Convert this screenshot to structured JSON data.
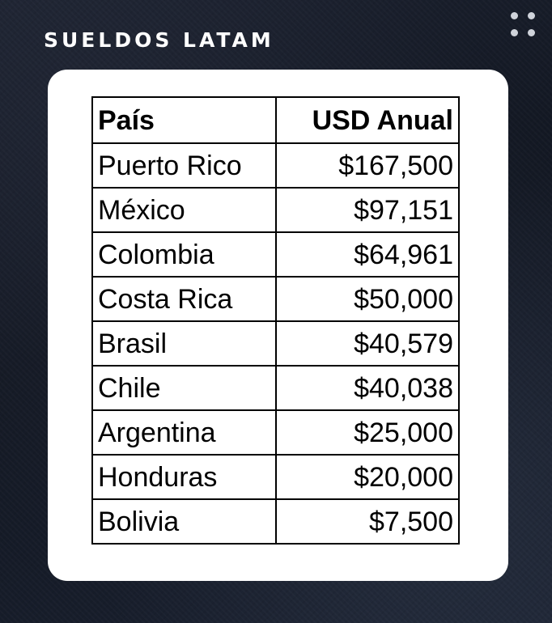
{
  "header": {
    "title": "SUELDOS LATAM"
  },
  "table": {
    "columns": [
      "País",
      "USD Anual"
    ],
    "rows": [
      {
        "country": "Puerto Rico",
        "usd": "$167,500"
      },
      {
        "country": "México",
        "usd": "$97,151"
      },
      {
        "country": "Colombia",
        "usd": "$64,961"
      },
      {
        "country": "Costa Rica",
        "usd": "$50,000"
      },
      {
        "country": "Brasil",
        "usd": "$40,579"
      },
      {
        "country": "Chile",
        "usd": "$40,038"
      },
      {
        "country": "Argentina",
        "usd": "$25,000"
      },
      {
        "country": "Honduras",
        "usd": "$20,000"
      },
      {
        "country": "Bolivia",
        "usd": "$7,500"
      }
    ]
  },
  "colors": {
    "background": "#121722",
    "card": "#ffffff",
    "title": "#ffffff",
    "dots": "#cfd3da"
  },
  "icons": {
    "corner": "dots-grid-icon"
  }
}
